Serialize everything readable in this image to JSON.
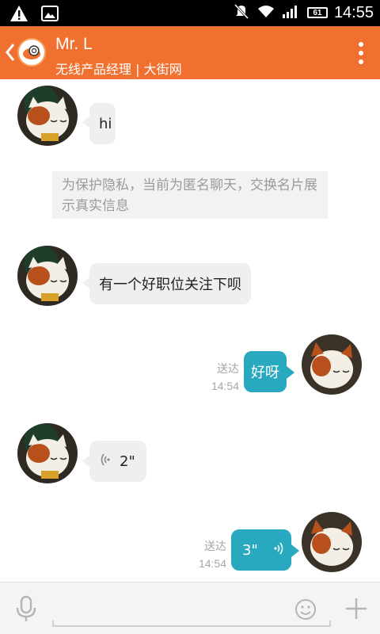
{
  "status_bar": {
    "time": "14:55",
    "battery_level": "61",
    "icons": [
      "warning-icon",
      "image-icon",
      "mute-icon",
      "wifi-icon",
      "signal-icon",
      "battery-icon"
    ]
  },
  "header": {
    "contact_name": "Mr. L",
    "contact_subtitle": "无线产品经理 | 大街网",
    "icons": [
      "back-chevron-icon",
      "app-logo-icon",
      "overflow-menu-icon"
    ]
  },
  "messages": [
    {
      "direction": "in",
      "type": "text",
      "text": "hi"
    },
    {
      "direction": "system",
      "type": "notice",
      "text": "为保护隐私，当前为匿名聊天，交换名片展示真实信息"
    },
    {
      "direction": "in",
      "type": "text",
      "text": "有一个好职位关注下呗"
    },
    {
      "direction": "out",
      "type": "text",
      "text": "好呀",
      "status": "送达",
      "time": "14:54"
    },
    {
      "direction": "in",
      "type": "voice",
      "duration": "2\""
    },
    {
      "direction": "out",
      "type": "voice",
      "duration": "3\"",
      "status": "送达",
      "time": "14:54"
    }
  ],
  "input_bar": {
    "placeholder": "",
    "icons": [
      "microphone-icon",
      "emoji-icon",
      "plus-icon"
    ]
  },
  "colors": {
    "header": "#f07030",
    "outgoing_bubble": "#29a9bf",
    "incoming_bubble": "#efefef",
    "status_bar": "#000000"
  }
}
